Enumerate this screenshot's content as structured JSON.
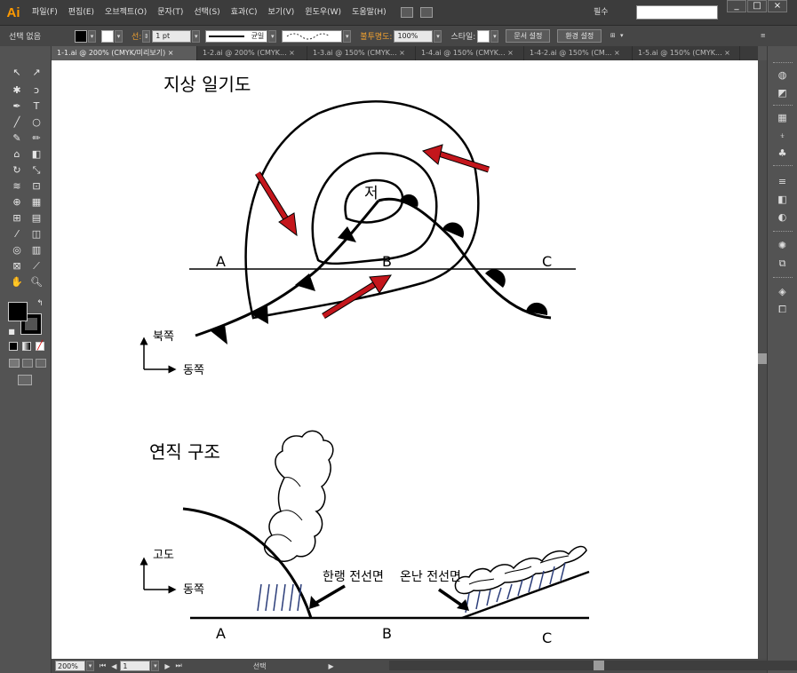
{
  "app": {
    "logo": "Ai"
  },
  "menu": [
    "파일(F)",
    "편집(E)",
    "오브젝트(O)",
    "문자(T)",
    "선택(S)",
    "효과(C)",
    "보기(V)",
    "윈도우(W)",
    "도움말(H)"
  ],
  "workspace_label": "필수",
  "window_buttons": [
    "_",
    "□",
    "×"
  ],
  "control": {
    "selection": "선택 없음",
    "stroke_label": "선:",
    "stroke_weight": "1 pt",
    "stroke_profile": "균일",
    "opacity_label": "불투명도:",
    "opacity_value": "100%",
    "style_label": "스타일:",
    "doc_setup": "문서 설정",
    "prefs": "환경 설정",
    "fill_color": "#000000",
    "stroke_color": "#000000"
  },
  "tabs": [
    {
      "label": "1-1.ai @ 200% (CMYK/미리보기)",
      "active": true
    },
    {
      "label": "1-2.ai @ 200% (CMYK...",
      "active": false
    },
    {
      "label": "1-3.ai @ 150% (CMYK...",
      "active": false
    },
    {
      "label": "1-4.ai @ 150% (CMYK...",
      "active": false
    },
    {
      "label": "1-4-2.ai @ 150% (CM...",
      "active": false
    },
    {
      "label": "1-5.ai @ 150% (CMYK...",
      "active": false
    }
  ],
  "status": {
    "zoom": "200%",
    "page": "1",
    "tool": "선택"
  },
  "figure": {
    "map_title": "지상 일기도",
    "low_label": "저",
    "section_labels": [
      "A",
      "B",
      "C"
    ],
    "compass_north": "북쪽",
    "compass_east": "동쪽",
    "vertical_title": "연직 구조",
    "altitude_label": "고도",
    "cold_front_label": "한랭 전선면",
    "warm_front_label": "온난 전선면",
    "arrow_color": "#c4161c"
  }
}
